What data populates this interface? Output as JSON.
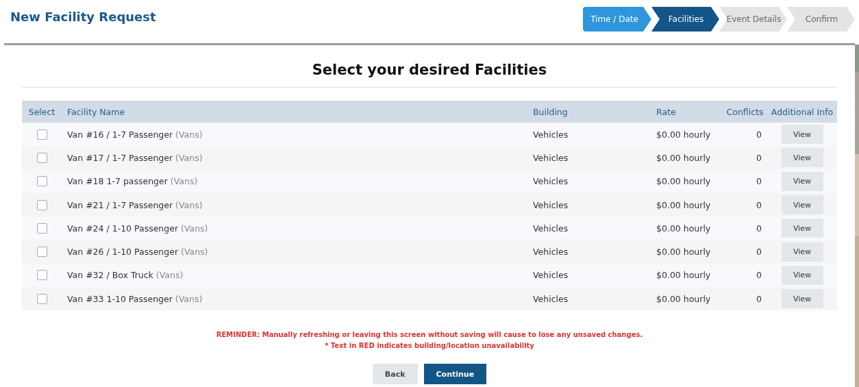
{
  "header": {
    "title": "New Facility Request"
  },
  "steps": [
    {
      "label": "Time / Date",
      "completed": true,
      "selected": false
    },
    {
      "label": "Facilities",
      "completed": false,
      "selected": true
    },
    {
      "label": "Event Details",
      "completed": false,
      "selected": false
    },
    {
      "label": "Confirm",
      "completed": false,
      "selected": false
    }
  ],
  "heading": "Select your desired Facilities",
  "table": {
    "columns": [
      "Select",
      "Facility Name",
      "Building",
      "Rate",
      "Conflicts",
      "Additional Info"
    ],
    "rows": [
      {
        "checked": false,
        "name": "Van #16 / 1-7 Passenger",
        "category": "(Vans)",
        "building": "Vehicles",
        "rate": "$0.00 hourly",
        "conflicts": "0",
        "action": "View"
      },
      {
        "checked": false,
        "name": "Van #17 / 1-7 Passenger",
        "category": "(Vans)",
        "building": "Vehicles",
        "rate": "$0.00 hourly",
        "conflicts": "0",
        "action": "View"
      },
      {
        "checked": false,
        "name": "Van #18 1-7 passenger",
        "category": "(Vans)",
        "building": "Vehicles",
        "rate": "$0.00 hourly",
        "conflicts": "0",
        "action": "View"
      },
      {
        "checked": false,
        "name": "Van #21 / 1-7 Passenger",
        "category": "(Vans)",
        "building": "Vehicles",
        "rate": "$0.00 hourly",
        "conflicts": "0",
        "action": "View"
      },
      {
        "checked": false,
        "name": "Van #24 / 1-10 Passenger",
        "category": "(Vans)",
        "building": "Vehicles",
        "rate": "$0.00 hourly",
        "conflicts": "0",
        "action": "View"
      },
      {
        "checked": false,
        "name": "Van #26 / 1-10 Passenger",
        "category": "(Vans)",
        "building": "Vehicles",
        "rate": "$0.00 hourly",
        "conflicts": "0",
        "action": "View"
      },
      {
        "checked": false,
        "name": "Van #32 / Box Truck",
        "category": "(Vans)",
        "building": "Vehicles",
        "rate": "$0.00 hourly",
        "conflicts": "0",
        "action": "View"
      },
      {
        "checked": false,
        "name": "Van #33 1-10 Passenger",
        "category": "(Vans)",
        "building": "Vehicles",
        "rate": "$0.00 hourly",
        "conflicts": "0",
        "action": "View"
      }
    ]
  },
  "notices": [
    "REMINDER: Manually refreshing or leaving this screen without saving will cause to lose any unsaved changes.",
    "* Text in RED indicates building/location unavailability"
  ],
  "buttons": [
    {
      "label": "Back",
      "kind": "secondary"
    },
    {
      "label": "Continue",
      "kind": "primary"
    }
  ]
}
